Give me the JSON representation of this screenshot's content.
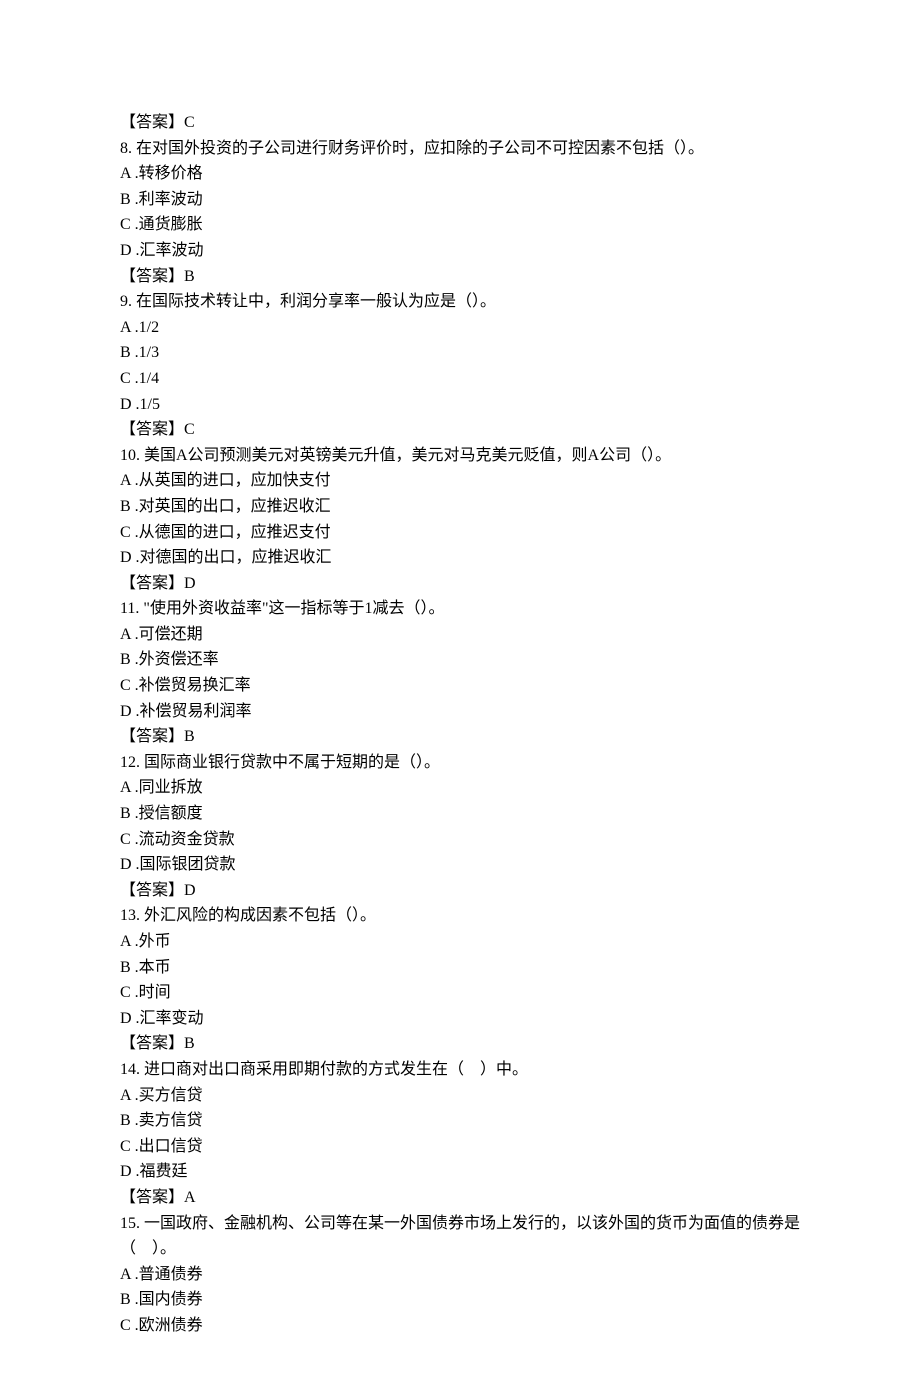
{
  "lines": [
    "【答案】C",
    "8.  在对国外投资的子公司进行财务评价时，应扣除的子公司不可控因素不包括（）。",
    "A .转移价格",
    "B .利率波动",
    "C .通货膨胀",
    "D .汇率波动",
    "【答案】B",
    "9.  在国际技术转让中，利润分享率一般认为应是（）。",
    "A .1/2",
    "B .1/3",
    "C .1/4",
    "D .1/5",
    "【答案】C",
    "10.  美国A公司预测美元对英镑美元升值，美元对马克美元贬值，则A公司（）。",
    "A .从英国的进口，应加快支付",
    "B .对英国的出口，应推迟收汇",
    "C .从德国的进口，应推迟支付",
    "D .对德国的出口，应推迟收汇",
    "【答案】D",
    "11.  \"使用外资收益率\"这一指标等于1减去（）。",
    "A .可偿还期",
    "B .外资偿还率",
    "C .补偿贸易换汇率",
    "D .补偿贸易利润率",
    "【答案】B",
    "12.  国际商业银行贷款中不属于短期的是（）。",
    "A .同业拆放",
    "B .授信额度",
    "C .流动资金贷款",
    "D .国际银团贷款",
    "【答案】D",
    "13.  外汇风险的构成因素不包括（）。",
    "A .外币",
    "B .本币",
    "C .时间",
    "D .汇率变动",
    "【答案】B",
    "14.  进口商对出口商采用即期付款的方式发生在（　）中。",
    "A .买方信贷",
    "B .卖方信贷",
    "C .出口信贷",
    "D .福费廷",
    "【答案】A",
    "15.  一国政府、金融机构、公司等在某一外国债券市场上发行的，以该外国的货币为面值的债券是（　）。",
    "A .普通债券",
    "B .国内债券",
    "C .欧洲债券"
  ]
}
